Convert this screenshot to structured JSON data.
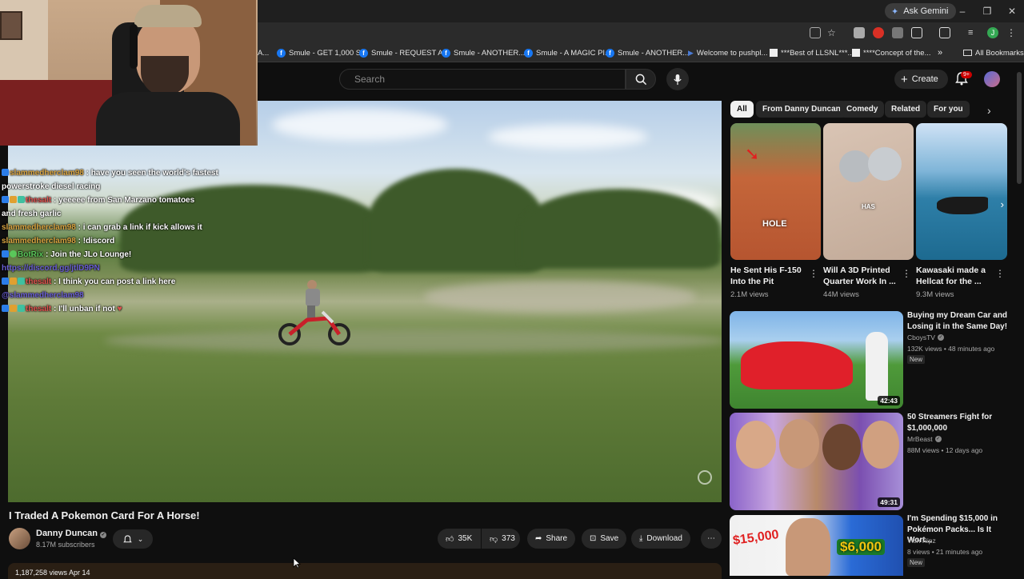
{
  "browser": {
    "ask_gemini": "Ask Gemini",
    "bookmarks": [
      {
        "label": "A..."
      },
      {
        "label": "Smule - GET 1,000 S..."
      },
      {
        "label": "Smule - REQUEST A..."
      },
      {
        "label": "Smule - ANOTHER..."
      },
      {
        "label": "Smule - A MAGIC PI..."
      },
      {
        "label": "Smule - ANOTHER..."
      },
      {
        "label": "Welcome to pushpl..."
      },
      {
        "label": "***Best of LLSNL***..."
      },
      {
        "label": "****Concept of the..."
      }
    ],
    "bookmarks_more": "»",
    "all_bookmarks": "All Bookmarks"
  },
  "header": {
    "search_placeholder": "Search",
    "create_label": "Create",
    "notif_count": "9+"
  },
  "chat": [
    {
      "user": "slammedherclam98",
      "user_color": "yellow",
      "text": " : have you seen the world's fastest"
    },
    {
      "user": "",
      "text": "powerstroke diesel racing"
    },
    {
      "user": "thesalt",
      "user_color": "red",
      "text": " : yeeeee from San Marzano tomatoes"
    },
    {
      "user": "",
      "text": "and fresh garlic"
    },
    {
      "user": "slammedherclam98",
      "user_color": "yellow",
      "text": " : i can grab a link if kick allows it"
    },
    {
      "user": "slammedherclam98",
      "user_color": "yellow",
      "text": " : !discord"
    },
    {
      "user": "BotRix",
      "user_color": "green",
      "text": " : Join the JLo Lounge!"
    },
    {
      "user": "",
      "text": "https://discord.gg/jtlD9PN",
      "link": true
    },
    {
      "user": "thesalt",
      "user_color": "red",
      "text": " : I think you can post a link here"
    },
    {
      "user": "",
      "text": "@slammedherclam98",
      "link": true
    },
    {
      "user": "thesalt",
      "user_color": "red",
      "text": " : I'll unban if not"
    }
  ],
  "video": {
    "title": "I Traded A Pokemon Card For A Horse!",
    "channel": "Danny Duncan",
    "subscribers": "8.17M subscribers",
    "likes": "35K",
    "dislikes": "373",
    "share": "Share",
    "save": "Save",
    "download": "Download",
    "description_meta": "1,187,258 views  Apr 14"
  },
  "chips": [
    "All",
    "From Danny Duncan",
    "Comedy",
    "Related",
    "For you"
  ],
  "shorts": [
    {
      "title": "He Sent His F-150 Into the Pit",
      "views": "2.1M views",
      "overlay": "HOLE"
    },
    {
      "title": "Will A 3D Printed Quarter Work In ...",
      "views": "44M views",
      "overlay": "HAS"
    },
    {
      "title": "Kawasaki made a Hellcat for the ...",
      "views": "9.3M views",
      "overlay": ""
    }
  ],
  "recommendations": [
    {
      "title": "Buying my Dream Car and Losing it in the Same Day!",
      "channel": "CboysTV",
      "meta": "132K views • 48 minutes ago",
      "badge": "New",
      "duration": "42:43"
    },
    {
      "title": "50 Streamers Fight for $1,000,000",
      "channel": "MrBeast",
      "meta": "88M views • 12 days ago",
      "badge": "",
      "duration": "49:31"
    },
    {
      "title": "I'm Spending $15,000 in Pokémon Packs... Is It Wort...",
      "channel": "Vish Ripz",
      "meta": "8 views • 21 minutes ago",
      "badge": "New",
      "duration": "",
      "thumb_text_1": "$15,000",
      "thumb_text_2": "$6,000"
    }
  ],
  "colors": {
    "accent_red": "#cc0000",
    "chat_yellow": "#d9a441",
    "chat_red": "#e0524f",
    "chat_green": "#5ac75a"
  }
}
